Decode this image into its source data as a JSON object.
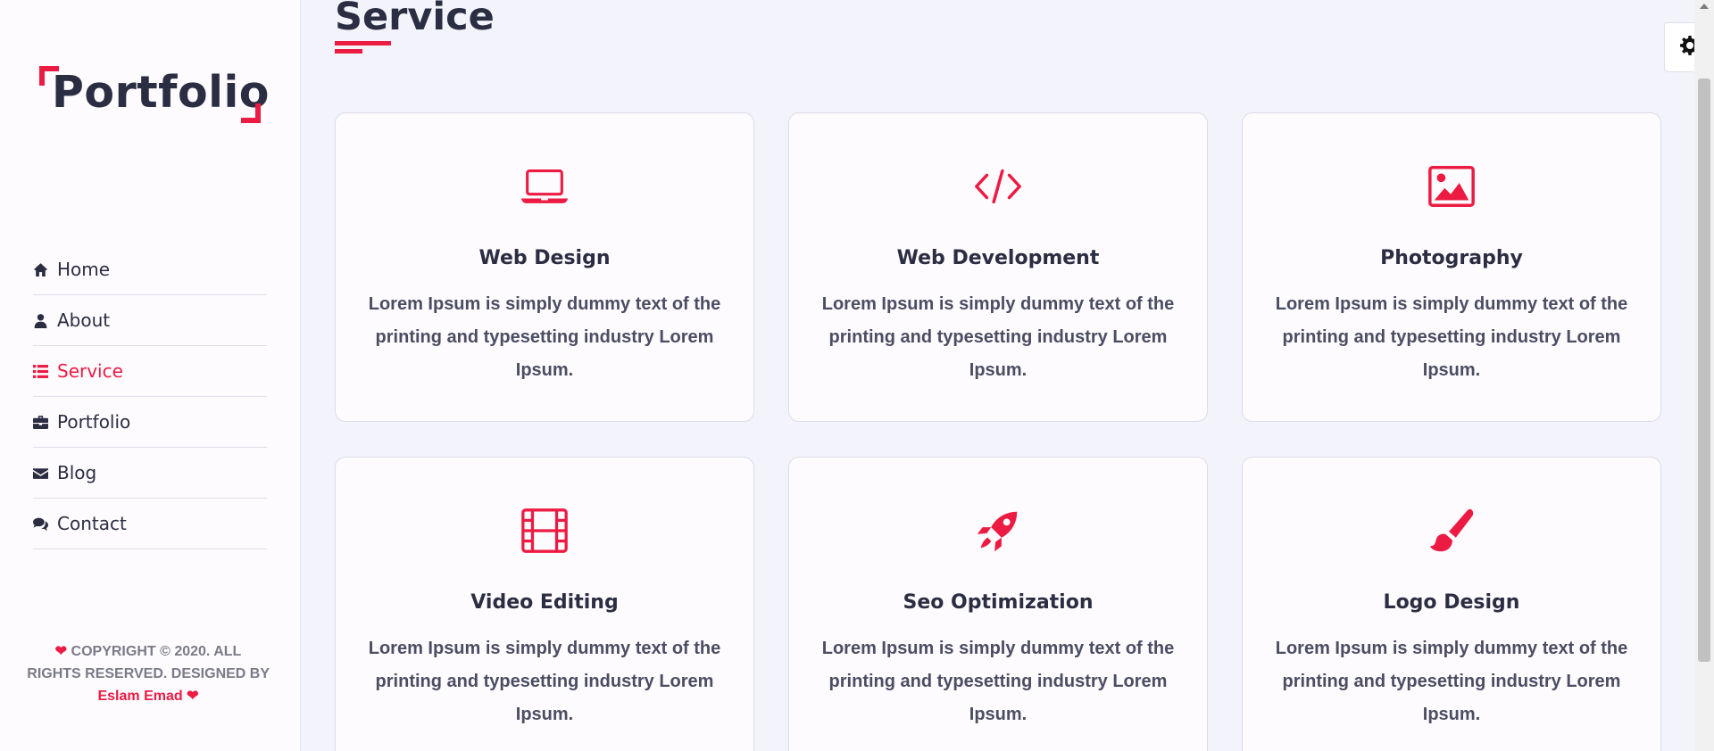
{
  "logo": {
    "text": "Portfolio"
  },
  "nav": {
    "items": [
      {
        "label": "Home",
        "icon": "home-icon"
      },
      {
        "label": "About",
        "icon": "user-icon"
      },
      {
        "label": "Service",
        "icon": "list-icon",
        "active": true
      },
      {
        "label": "Portfolio",
        "icon": "briefcase-icon"
      },
      {
        "label": "Blog",
        "icon": "envelope-icon"
      },
      {
        "label": "Contact",
        "icon": "comments-icon"
      }
    ]
  },
  "footer": {
    "text": "COPYRIGHT © 2020. ALL RIGHTS RESERVED. DESIGNED BY",
    "author": "Eslam Emad",
    "heart_icon": "heart-icon"
  },
  "main": {
    "title": "Service",
    "services": [
      {
        "title": "Web Design",
        "text": "Lorem Ipsum is simply dummy text of the printing and typesetting industry Lorem Ipsum.",
        "icon": "laptop-icon"
      },
      {
        "title": "Web Development",
        "text": "Lorem Ipsum is simply dummy text of the printing and typesetting industry Lorem Ipsum.",
        "icon": "code-icon"
      },
      {
        "title": "Photography",
        "text": "Lorem Ipsum is simply dummy text of the printing and typesetting industry Lorem Ipsum.",
        "icon": "image-icon"
      },
      {
        "title": "Video Editing",
        "text": "Lorem Ipsum is simply dummy text of the printing and typesetting industry Lorem Ipsum.",
        "icon": "film-icon"
      },
      {
        "title": "Seo Optimization",
        "text": "Lorem Ipsum is simply dummy text of the printing and typesetting industry Lorem Ipsum.",
        "icon": "rocket-icon"
      },
      {
        "title": "Logo Design",
        "text": "Lorem Ipsum is simply dummy text of the printing and typesetting industry Lorem Ipsum.",
        "icon": "paint-brush-icon"
      }
    ]
  },
  "settings": {
    "icon": "gear-icon"
  },
  "colors": {
    "accent": "#ec1b43",
    "text": "#2b2d42",
    "background": "#f2f3fb",
    "sidebar": "#fdfbfd"
  }
}
